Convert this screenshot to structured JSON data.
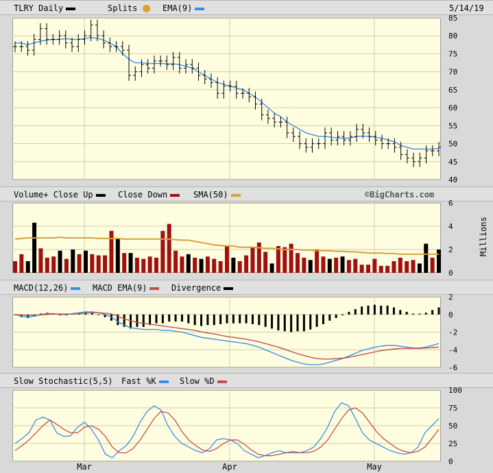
{
  "header": {
    "ticker": "TLRY Daily",
    "splits": "Splits",
    "ema": "EMA(9)",
    "date": "5/14/19"
  },
  "volume_header": {
    "volume": "Volume+ Close Up",
    "down": "Close Down",
    "sma": "SMA(50)",
    "source": "©BigCharts.com",
    "units": "Millions"
  },
  "macd_header": {
    "macd": "MACD(12,26)",
    "ema": "MACD EMA(9)",
    "div": "Divergence"
  },
  "stoch_header": {
    "slow": "Slow Stochastic(5,5)",
    "fast": "Fast %K",
    "slowd": "Slow %D"
  },
  "colors": {
    "ema": "#3a8ee6",
    "up": "#000000",
    "down": "#a01010",
    "sma": "#d4a040",
    "signal": "#c0504d",
    "splits": "#e0a030"
  },
  "chart_data": [
    {
      "type": "ohlc",
      "title": "TLRY Daily",
      "x_labels": [
        "Mar",
        "Apr",
        "May"
      ],
      "ylim": [
        40,
        85
      ],
      "y_ticks": [
        40,
        45,
        50,
        55,
        60,
        65,
        70,
        75,
        80,
        85
      ],
      "close": [
        77,
        77,
        76,
        79,
        82,
        79,
        79,
        80,
        78,
        77,
        79,
        80,
        83,
        80,
        78,
        77,
        77,
        76,
        69,
        70,
        72,
        71,
        73,
        73,
        72,
        74,
        71,
        72,
        71,
        69,
        68,
        67,
        64,
        66,
        66,
        64,
        64,
        63,
        61,
        58,
        57,
        56,
        56,
        53,
        52,
        50,
        49,
        50,
        50,
        53,
        51,
        52,
        51,
        52,
        54,
        53,
        52,
        51,
        50,
        50,
        49,
        47,
        46,
        45,
        46,
        48,
        48,
        49
      ],
      "ema9": [
        78,
        78,
        77.5,
        78,
        78.5,
        78.8,
        79,
        79,
        79.2,
        79,
        79,
        79.2,
        79.5,
        79.3,
        78.8,
        78,
        77,
        75,
        73.5,
        72.5,
        72.5,
        72.3,
        72.3,
        72.3,
        72.2,
        72.2,
        72,
        71.5,
        71,
        70,
        69,
        68,
        67,
        66.5,
        66,
        65.5,
        65,
        64,
        63,
        61.5,
        60,
        58.5,
        57.5,
        56,
        55,
        54,
        53,
        52.5,
        52,
        52,
        51.8,
        51.6,
        51.5,
        51.6,
        52,
        52.1,
        52,
        51.8,
        51.5,
        51,
        50.5,
        49.5,
        49,
        48.5,
        48.5,
        48.5,
        48.5,
        48.7
      ]
    },
    {
      "type": "bar",
      "title": "Volume+ Close Up",
      "ylabel": "Millions",
      "ylim": [
        0,
        6
      ],
      "y_ticks": [
        0,
        2,
        4,
        6
      ],
      "volume": [
        1.0,
        1.6,
        1.0,
        4.3,
        2.1,
        1.3,
        1.4,
        1.9,
        1.2,
        2.0,
        1.6,
        1.9,
        1.6,
        1.5,
        1.5,
        3.6,
        3.0,
        1.7,
        1.7,
        1.3,
        1.2,
        1.4,
        1.3,
        3.6,
        4.2,
        1.9,
        1.4,
        1.6,
        1.3,
        1.2,
        1.4,
        1.2,
        1.0,
        2.3,
        1.3,
        1.0,
        1.5,
        2.2,
        2.6,
        1.8,
        0.8,
        2.3,
        2.2,
        2.5,
        1.7,
        1.3,
        1.1,
        2.0,
        1.4,
        1.2,
        1.3,
        1.4,
        1.1,
        1.2,
        0.7,
        0.7,
        1.2,
        0.6,
        0.6,
        1.0,
        1.3,
        1.0,
        1.1,
        0.8,
        2.5,
        1.3,
        2.0
      ],
      "up_days": [
        false,
        false,
        true,
        true,
        false,
        false,
        false,
        true,
        false,
        true,
        false,
        true,
        false,
        false,
        false,
        false,
        true,
        false,
        true,
        false,
        false,
        false,
        false,
        false,
        false,
        false,
        false,
        true,
        false,
        true,
        false,
        false,
        false,
        false,
        true,
        false,
        false,
        false,
        false,
        false,
        true,
        false,
        false,
        false,
        false,
        false,
        true,
        false,
        false,
        true,
        false,
        true,
        false,
        false,
        false,
        false,
        false,
        false,
        false,
        false,
        false,
        false,
        false,
        true,
        true,
        false,
        true
      ],
      "sma50": [
        2.9,
        2.95,
        3.0,
        3.0,
        3.0,
        3.0,
        3.0,
        3.05,
        3.0,
        3.0,
        3.0,
        3.0,
        3.0,
        2.95,
        2.95,
        2.95,
        2.95,
        2.9,
        2.9,
        2.9,
        2.9,
        2.9,
        2.9,
        2.9,
        2.9,
        2.85,
        2.8,
        2.8,
        2.7,
        2.6,
        2.5,
        2.4,
        2.35,
        2.3,
        2.3,
        2.2,
        2.2,
        2.2,
        2.15,
        2.1,
        2.1,
        2.05,
        2.0,
        2.0,
        2.0,
        1.95,
        1.95,
        1.9,
        1.9,
        1.9,
        1.85,
        1.85,
        1.8,
        1.8,
        1.75,
        1.7,
        1.7,
        1.7,
        1.65,
        1.65,
        1.6,
        1.6,
        1.6,
        1.6,
        1.6,
        1.6,
        1.6
      ]
    },
    {
      "type": "line",
      "title": "MACD(12,26)",
      "ylim": [
        -6,
        2
      ],
      "y_ticks": [
        -6,
        -4,
        -2,
        0,
        2
      ],
      "macd": [
        0.0,
        -0.2,
        -0.3,
        -0.2,
        0.0,
        0.1,
        0.1,
        0.0,
        0.0,
        0.1,
        0.2,
        0.3,
        0.3,
        0.2,
        0.0,
        -0.3,
        -0.8,
        -1.2,
        -1.5,
        -1.6,
        -1.7,
        -1.7,
        -1.7,
        -1.8,
        -1.8,
        -1.9,
        -2.0,
        -2.2,
        -2.4,
        -2.6,
        -2.7,
        -2.8,
        -2.9,
        -3.0,
        -3.1,
        -3.2,
        -3.3,
        -3.5,
        -3.7,
        -4.0,
        -4.3,
        -4.6,
        -4.9,
        -5.2,
        -5.4,
        -5.6,
        -5.7,
        -5.7,
        -5.6,
        -5.4,
        -5.2,
        -5.0,
        -4.7,
        -4.4,
        -4.1,
        -3.9,
        -3.7,
        -3.6,
        -3.5,
        -3.5,
        -3.6,
        -3.7,
        -3.8,
        -3.8,
        -3.7,
        -3.5,
        -3.3
      ],
      "signal": [
        0.0,
        -0.05,
        -0.1,
        -0.1,
        -0.05,
        0.0,
        0.05,
        0.05,
        0.05,
        0.05,
        0.1,
        0.15,
        0.2,
        0.2,
        0.15,
        0.05,
        -0.2,
        -0.5,
        -0.7,
        -0.9,
        -1.0,
        -1.1,
        -1.2,
        -1.3,
        -1.4,
        -1.5,
        -1.6,
        -1.7,
        -1.8,
        -1.95,
        -2.1,
        -2.2,
        -2.35,
        -2.5,
        -2.6,
        -2.7,
        -2.8,
        -2.95,
        -3.1,
        -3.3,
        -3.5,
        -3.7,
        -3.95,
        -4.2,
        -4.45,
        -4.65,
        -4.85,
        -5.0,
        -5.05,
        -5.05,
        -5.0,
        -4.95,
        -4.85,
        -4.7,
        -4.55,
        -4.4,
        -4.25,
        -4.1,
        -4.0,
        -3.9,
        -3.85,
        -3.85,
        -3.85,
        -3.85,
        -3.8,
        -3.75,
        -3.7
      ]
    },
    {
      "type": "line",
      "title": "Slow Stochastic(5,5)",
      "ylim": [
        0,
        100
      ],
      "y_ticks": [
        0,
        25,
        50,
        75,
        100
      ],
      "fast_k": [
        25,
        32,
        40,
        58,
        62,
        58,
        40,
        35,
        36,
        48,
        55,
        45,
        30,
        10,
        5,
        15,
        22,
        35,
        55,
        70,
        78,
        72,
        50,
        35,
        25,
        20,
        15,
        12,
        18,
        30,
        32,
        30,
        25,
        15,
        10,
        5,
        8,
        12,
        15,
        12,
        14,
        12,
        15,
        20,
        32,
        48,
        70,
        82,
        78,
        60,
        40,
        30,
        25,
        20,
        15,
        12,
        10,
        12,
        20,
        40,
        50,
        60
      ],
      "slow_d": [
        15,
        22,
        30,
        40,
        50,
        58,
        52,
        45,
        40,
        40,
        48,
        50,
        45,
        35,
        20,
        12,
        12,
        18,
        30,
        45,
        60,
        70,
        68,
        58,
        42,
        30,
        22,
        16,
        14,
        18,
        25,
        30,
        30,
        24,
        16,
        10,
        8,
        8,
        10,
        12,
        12,
        12,
        12,
        14,
        20,
        30,
        45,
        60,
        72,
        75,
        68,
        55,
        42,
        32,
        25,
        18,
        14,
        12,
        14,
        20,
        32,
        45
      ]
    }
  ]
}
